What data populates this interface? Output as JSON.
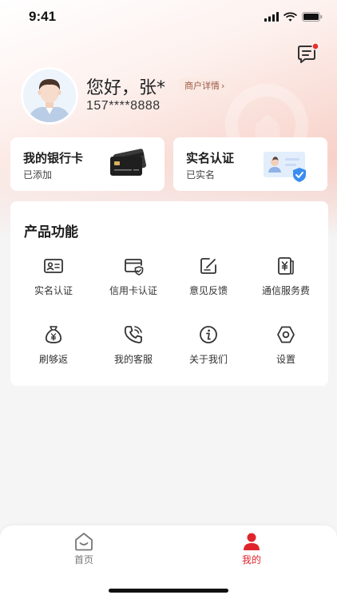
{
  "status_bar": {
    "time": "9:41"
  },
  "profile": {
    "greeting": "您好，张*",
    "merchant_link": "商户详情",
    "phone": "157****8888"
  },
  "cards": {
    "bank_card": {
      "title": "我的银行卡",
      "status": "已添加"
    },
    "real_name": {
      "title": "实名认证",
      "status": "已实名"
    }
  },
  "products": {
    "title": "产品功能",
    "items": [
      {
        "label": "实名认证",
        "icon": "id-card-icon"
      },
      {
        "label": "信用卡认证",
        "icon": "credit-card-shield-icon"
      },
      {
        "label": "意见反馈",
        "icon": "edit-icon"
      },
      {
        "label": "通信服务费",
        "icon": "yen-bill-icon"
      },
      {
        "label": "刷够返",
        "icon": "money-bag-icon"
      },
      {
        "label": "我的客服",
        "icon": "phone-icon"
      },
      {
        "label": "关于我们",
        "icon": "info-icon"
      },
      {
        "label": "设置",
        "icon": "settings-hexagon-icon"
      }
    ]
  },
  "tabbar": {
    "home": "首页",
    "mine": "我的"
  },
  "colors": {
    "accent": "#e0242b",
    "header_pink": "#f6c3b9",
    "notification_dot": "#ea2d2d"
  }
}
